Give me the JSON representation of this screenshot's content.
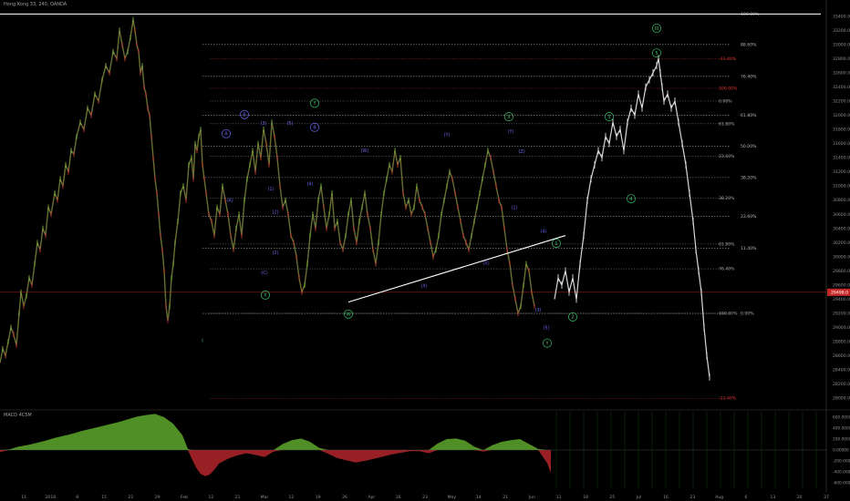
{
  "chart_data": {
    "type": "line",
    "title": "Hong Kong 33, 240, OANDA",
    "price_ticks": [
      "33400.0",
      "33200.0",
      "33000.0",
      "32800.0",
      "32600.0",
      "32400.0",
      "32200.0",
      "32000.0",
      "31800.0",
      "31600.0",
      "31400.0",
      "31200.0",
      "31000.0",
      "30800.0",
      "30600.0",
      "30400.0",
      "30200.0",
      "30000.0",
      "29800.0",
      "29600.0",
      "29400.0",
      "29200.0",
      "29000.0",
      "28800.0",
      "28600.0",
      "28400.0",
      "28200.0",
      "28000.0"
    ],
    "price_range": [
      27900,
      33500
    ],
    "current_price": "29498.0",
    "x_ticks": [
      "11",
      "2018",
      "8",
      "15",
      "22",
      "29",
      "Feb",
      "12",
      "21",
      "Mar",
      "12",
      "19",
      "26",
      "Apr",
      "16",
      "23",
      "May",
      "14",
      "21",
      "Jun",
      "11",
      "18",
      "25",
      "Jul",
      "16",
      "23",
      "Aug",
      "6",
      "13",
      "20",
      "27"
    ],
    "historical_series": {
      "name": "HK33",
      "x": [
        0,
        3,
        6,
        9,
        12,
        15,
        18,
        21,
        23,
        26,
        29,
        32,
        35,
        38,
        41,
        44,
        47,
        50,
        53,
        56,
        60,
        63,
        66,
        69,
        72,
        75,
        78,
        81,
        84,
        88,
        92,
        96,
        100,
        104,
        108,
        112,
        116,
        120,
        124,
        128,
        131,
        134,
        137,
        140,
        143,
        146,
        148,
        150,
        152,
        154,
        156,
        158,
        160,
        162,
        164,
        166,
        168,
        170,
        172,
        174,
        176,
        178,
        180,
        182,
        184,
        186,
        188,
        190,
        192,
        195,
        198,
        201,
        204,
        207,
        210,
        212,
        214,
        216,
        218,
        220,
        222,
        224,
        226,
        229,
        232,
        235,
        238,
        241,
        244,
        247,
        250,
        253,
        256,
        259,
        262,
        265,
        268,
        271,
        274,
        277,
        280,
        283,
        286,
        289,
        292,
        295,
        298,
        301,
        304,
        307,
        310,
        313,
        316,
        319,
        322,
        325,
        328,
        331,
        334,
        337,
        340,
        343,
        346,
        349,
        352,
        355,
        358,
        361,
        364,
        367,
        370,
        373,
        376,
        379,
        382,
        385,
        388,
        391,
        394,
        397,
        400,
        403,
        406,
        409,
        412,
        415,
        418,
        421,
        424,
        427,
        430,
        433,
        436,
        439,
        442,
        445,
        448,
        451,
        454,
        457,
        460,
        463,
        466,
        469,
        472,
        475,
        478,
        481,
        484,
        487,
        490,
        493,
        496,
        499,
        502,
        505,
        508,
        511,
        514,
        517,
        520,
        523,
        526,
        529,
        532,
        535,
        538,
        541,
        544,
        547,
        550,
        553,
        556,
        559,
        562,
        565,
        568,
        571,
        574,
        577,
        580,
        583,
        586,
        589,
        592,
        595,
        598,
        601,
        604,
        607
      ],
      "y": [
        28500,
        28700,
        28600,
        28800,
        29000,
        28900,
        28750,
        29200,
        29500,
        29300,
        29450,
        29700,
        29600,
        29900,
        30200,
        30100,
        30400,
        30300,
        30700,
        30600,
        30900,
        30800,
        31100,
        31000,
        31300,
        31200,
        31500,
        31450,
        31700,
        31900,
        31800,
        32100,
        32000,
        32300,
        32200,
        32500,
        32700,
        32600,
        32900,
        32800,
        33200,
        33000,
        32800,
        32900,
        33100,
        33350,
        33200,
        33000,
        32900,
        32600,
        32700,
        32400,
        32300,
        32100,
        32000,
        31700,
        31400,
        31100,
        30900,
        30600,
        30300,
        30100,
        29800,
        29300,
        29100,
        29300,
        29700,
        29900,
        30200,
        30500,
        30900,
        31000,
        30800,
        31300,
        31400,
        31100,
        31600,
        31500,
        31700,
        31800,
        31300,
        31100,
        30900,
        30600,
        30500,
        30300,
        30700,
        30600,
        31000,
        30800,
        30600,
        30300,
        30100,
        30400,
        30600,
        30300,
        30800,
        31100,
        31300,
        31500,
        31200,
        31600,
        31400,
        31800,
        31600,
        31300,
        31900,
        31700,
        31400,
        31000,
        30700,
        30800,
        30600,
        30300,
        30200,
        30000,
        29700,
        29500,
        29600,
        29900,
        30300,
        30600,
        30400,
        30800,
        31000,
        30700,
        30400,
        30600,
        30900,
        30400,
        30500,
        30200,
        30100,
        30300,
        30600,
        30800,
        30400,
        30200,
        30500,
        30700,
        30900,
        30600,
        30400,
        30100,
        29900,
        30200,
        30600,
        30900,
        31100,
        31300,
        31200,
        31500,
        31300,
        31400,
        30900,
        30700,
        30800,
        30600,
        30700,
        31000,
        30800,
        30700,
        30600,
        30400,
        30200,
        30000,
        30100,
        30300,
        30600,
        30800,
        31000,
        31200,
        31100,
        30900,
        30700,
        30500,
        30300,
        30200,
        30100,
        30300,
        30500,
        30700,
        30900,
        31100,
        31300,
        31500,
        31400,
        31200,
        31000,
        30800,
        30700,
        30400,
        30100,
        29900,
        29600,
        29400,
        29200,
        29300,
        29600,
        29900,
        29800,
        29500,
        29300
      ]
    },
    "projection_series": {
      "name": "projection",
      "x": [
        608,
        612,
        616,
        620,
        624,
        628,
        632,
        636,
        640,
        644,
        648,
        652,
        656,
        660,
        664,
        668,
        672,
        676,
        680,
        684,
        688,
        692,
        696,
        700,
        704,
        708,
        712,
        716,
        720,
        722,
        724,
        726,
        728,
        732,
        736,
        740,
        744,
        748,
        752,
        756,
        760,
        763,
        766,
        769,
        772,
        775,
        778
      ],
      "y": [
        29400,
        29700,
        29600,
        29800,
        29500,
        29700,
        29400,
        29900,
        30300,
        30800,
        31100,
        31300,
        31500,
        31400,
        31700,
        31600,
        31900,
        31700,
        31800,
        31500,
        31900,
        32100,
        32000,
        32300,
        32100,
        32400,
        32500,
        32600,
        32700,
        32800,
        32600,
        32400,
        32200,
        32300,
        32100,
        32200,
        31900,
        31600,
        31300,
        30900,
        30500,
        30100,
        29800,
        29500,
        29000,
        28600,
        28300
      ]
    },
    "trendline": {
      "x": [
        382,
        620
      ],
      "y": [
        29360,
        30300
      ]
    },
    "top_line": {
      "x": [
        0,
        900
      ],
      "y": [
        33430,
        33430
      ]
    },
    "fib_retracement": {
      "x": [
        222,
        800
      ],
      "levels": [
        {
          "label": "100.00%",
          "value": 33430,
          "style": "solid"
        },
        {
          "label": "88.60%",
          "value": 33000,
          "style": "dotted"
        },
        {
          "label": "76.40%",
          "value": 32550,
          "style": "dotted"
        },
        {
          "label": "61.80%",
          "value": 32000,
          "style": "dotted"
        },
        {
          "label": "50.00%",
          "value": 31560,
          "style": "dotted"
        },
        {
          "label": "38.20%",
          "value": 31120,
          "style": "dotted"
        },
        {
          "label": "23.60%",
          "value": 30570,
          "style": "dotted"
        },
        {
          "label": "11.40%",
          "value": 30120,
          "style": "dotted"
        },
        {
          "label": "0.00%",
          "value": 29200,
          "style": "dotted"
        }
      ]
    },
    "fib_extension": {
      "x": [
        230,
        800
      ],
      "levels": [
        {
          "label": "-11.40%",
          "value": 32800,
          "color": "#e03535"
        },
        {
          "label": "100.00%",
          "value": 32380,
          "color": "#e03535"
        },
        {
          "label": "0.00%",
          "value": 32200,
          "color": "#aaaaaa"
        },
        {
          "label": "61.80%",
          "value": 31880,
          "color": "#aaaaaa"
        },
        {
          "label": "23.60%",
          "value": 31420,
          "color": "#aaaaaa"
        },
        {
          "label": "38.20%",
          "value": 30830,
          "color": "#aaaaaa"
        },
        {
          "label": "61.80%",
          "value": 30180,
          "color": "#aaaaaa"
        },
        {
          "label": "76.40%",
          "value": 29830,
          "color": "#aaaaaa"
        },
        {
          "label": "100.00%",
          "value": 29200,
          "color": "#aaaaaa"
        },
        {
          "label": "-11.40%",
          "value": 28000,
          "color": "#e03535"
        }
      ]
    },
    "price_line": {
      "label": "29498.0",
      "value": 29498,
      "color": "#e03535"
    },
    "wave_labels": [
      {
        "text": "Y",
        "x": 345,
        "y": 32170,
        "color": "#39c46b",
        "circled": true
      },
      {
        "text": "III",
        "x": 720,
        "y": 33230,
        "color": "#39c46b",
        "circled": true
      },
      {
        "text": "5",
        "x": 720,
        "y": 32880,
        "color": "#39c46b",
        "circled": true
      },
      {
        "text": "3",
        "x": 668,
        "y": 31980,
        "color": "#39c46b",
        "circled": true
      },
      {
        "text": "X",
        "x": 558,
        "y": 31980,
        "color": "#39c46b",
        "circled": true
      },
      {
        "text": "4",
        "x": 692,
        "y": 30820,
        "color": "#39c46b",
        "circled": true
      },
      {
        "text": "1",
        "x": 610,
        "y": 30190,
        "color": "#39c46b",
        "circled": true
      },
      {
        "text": "X",
        "x": 291,
        "y": 29460,
        "color": "#39c46b",
        "circled": true
      },
      {
        "text": "W",
        "x": 382,
        "y": 29190,
        "color": "#39c46b",
        "circled": true
      },
      {
        "text": "2",
        "x": 628,
        "y": 29150,
        "color": "#39c46b",
        "circled": true
      },
      {
        "text": "Y",
        "x": 600,
        "y": 28780,
        "color": "#39c46b",
        "circled": true
      },
      {
        "text": "I",
        "x": 222,
        "y": 28820,
        "color": "#39c46b",
        "circled": false
      },
      {
        "text": "B",
        "x": 268,
        "y": 32010,
        "color": "#6a63e8",
        "circled": true
      },
      {
        "text": "B",
        "x": 345,
        "y": 31830,
        "color": "#6a63e8",
        "circled": true
      },
      {
        "text": "A",
        "x": 248,
        "y": 31740,
        "color": "#6a63e8",
        "circled": true
      },
      {
        "text": "(3)",
        "x": 289,
        "y": 31890,
        "color": "#6a63e8",
        "circled": false
      },
      {
        "text": "(5)",
        "x": 318,
        "y": 31890,
        "color": "#6a63e8",
        "circled": false
      },
      {
        "text": "(W)",
        "x": 400,
        "y": 31500,
        "color": "#6a63e8",
        "circled": false
      },
      {
        "text": "(Y)",
        "x": 490,
        "y": 31730,
        "color": "#6a63e8",
        "circled": false
      },
      {
        "text": "(Y)",
        "x": 560,
        "y": 31770,
        "color": "#6a63e8",
        "circled": false
      },
      {
        "text": "(Z)",
        "x": 572,
        "y": 31490,
        "color": "#6a63e8",
        "circled": false
      },
      {
        "text": "(1)",
        "x": 297,
        "y": 30960,
        "color": "#6a63e8",
        "circled": false
      },
      {
        "text": "(4)",
        "x": 340,
        "y": 31030,
        "color": "#6a63e8",
        "circled": false
      },
      {
        "text": "(A)",
        "x": 252,
        "y": 30800,
        "color": "#6a63e8",
        "circled": false
      },
      {
        "text": "(2)",
        "x": 302,
        "y": 30630,
        "color": "#6a63e8",
        "circled": false
      },
      {
        "text": "(C)",
        "x": 290,
        "y": 29780,
        "color": "#6a63e8",
        "circled": false
      },
      {
        "text": "(X)",
        "x": 465,
        "y": 29590,
        "color": "#6a63e8",
        "circled": false
      },
      {
        "text": "(X)",
        "x": 533,
        "y": 29910,
        "color": "#6a63e8",
        "circled": false
      },
      {
        "text": "(1)",
        "x": 564,
        "y": 30700,
        "color": "#6a63e8",
        "circled": false
      },
      {
        "text": "(4)",
        "x": 596,
        "y": 30360,
        "color": "#6a63e8",
        "circled": false
      },
      {
        "text": "(3)",
        "x": 590,
        "y": 29250,
        "color": "#6a63e8",
        "circled": false
      },
      {
        "text": "(5)",
        "x": 599,
        "y": 29000,
        "color": "#6a63e8",
        "circled": false
      },
      {
        "text": "(2)",
        "x": 302,
        "y": 30060,
        "color": "#6a63e8",
        "circled": false
      }
    ],
    "macd": {
      "label": "MACD 4C5M",
      "ticks": [
        "600.00000",
        "400.00000",
        "200.00000",
        "0.00000",
        "-200.00000",
        "-400.00000",
        "-600.00000"
      ],
      "range": [
        -700,
        700
      ],
      "x": [
        0,
        10,
        20,
        30,
        40,
        50,
        60,
        70,
        80,
        90,
        100,
        110,
        120,
        130,
        140,
        150,
        160,
        170,
        180,
        190,
        200,
        206,
        210,
        215,
        220,
        225,
        230,
        235,
        240,
        250,
        260,
        270,
        280,
        290,
        300,
        310,
        320,
        330,
        340,
        350,
        360,
        370,
        380,
        390,
        400,
        410,
        420,
        430,
        440,
        450,
        460,
        470,
        480,
        490,
        500,
        510,
        520,
        530,
        540,
        550,
        560,
        570,
        580,
        590,
        600,
        604
      ],
      "values": [
        -40,
        10,
        60,
        90,
        130,
        170,
        220,
        260,
        300,
        350,
        390,
        430,
        470,
        510,
        560,
        610,
        640,
        660,
        600,
        480,
        270,
        20,
        -150,
        -320,
        -440,
        -480,
        -450,
        -360,
        -250,
        -160,
        -100,
        -60,
        -90,
        -130,
        -30,
        110,
        180,
        210,
        150,
        40,
        -70,
        -150,
        -190,
        -230,
        -200,
        -160,
        -120,
        -80,
        -50,
        -20,
        -20,
        -60,
        120,
        200,
        210,
        170,
        60,
        -30,
        90,
        150,
        180,
        200,
        110,
        20,
        -240,
        -420
      ]
    }
  }
}
